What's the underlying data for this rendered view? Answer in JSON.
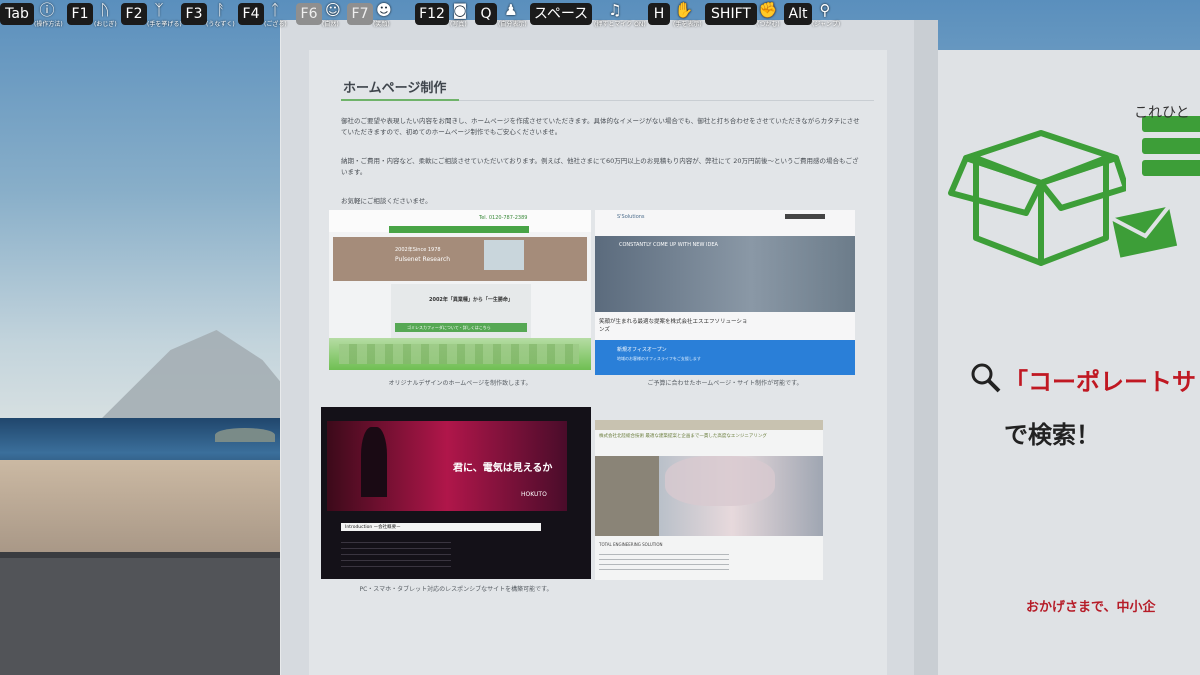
{
  "hud": {
    "keys": [
      {
        "key": "Tab",
        "icon": "info-icon",
        "label": "(操作方法)"
      },
      {
        "key": "F1",
        "icon": "bow-icon",
        "label": "(おじぎ)"
      },
      {
        "key": "F2",
        "icon": "raise-hand-icon",
        "label": "(手を挙げる)"
      },
      {
        "key": "F3",
        "icon": "nod-icon",
        "label": "(うなずく)"
      },
      {
        "key": "F4",
        "icon": "point-icon",
        "label": "(ござる)"
      },
      {
        "key": "F6",
        "icon": "smile-icon",
        "label": "(自然)"
      },
      {
        "key": "F7",
        "icon": "laugh-icon",
        "label": "(笑顔)"
      },
      {
        "key": "F12",
        "icon": "camera-icon",
        "label": "(写真)"
      },
      {
        "key": "Q",
        "icon": "self-view-icon",
        "label": "(自分表示)"
      },
      {
        "key": "スペース",
        "icon": "mic-icon",
        "label": "(押すとマイク ON)"
      },
      {
        "key": "H",
        "icon": "hand-icon",
        "label": "(手を表示)"
      },
      {
        "key": "SHIFT",
        "icon": "grab-icon",
        "label": "(つかむ)"
      },
      {
        "key": "Alt",
        "icon": "jump-icon",
        "label": "(ジャンプ)"
      }
    ]
  },
  "panel": {
    "title": "ホームページ制作",
    "para1": "御社のご要望や表現したい内容をお聞きし、ホームページを作成させていただきます。具体的なイメージがない場合でも、御社と打ち合わせをさせていただきながらカタチにさせていただきますので、初めてのホームページ制作でもご安心くださいませ。",
    "para2": "納期・ご費用・内容など、柔軟にご相談させていただいております。例えば、他社さまにて60万円以上のお見積もり内容が、弊社にて 20万円前後～というご費用感の場合もございます。",
    "para3": "お気軽にご相談くださいませ。",
    "captions": [
      "オリジナルデザインのホームページを制作致します。",
      "ご予算に合わせたホームページ・サイト制作が可能です。",
      "PC・スマホ・タブレット対応のレスポンシブなサイトを構築可能です。"
    ],
    "shot1": {
      "tel": "Tel. 0120-787-2389",
      "hero_title": "2002年Since 1978",
      "hero_sub": "Pulsenet Research",
      "banner": "2002年「異業種」から「一生勝命」",
      "cta": "ゴミレスカフィーダについて・詳しくはこちら"
    },
    "shot2": {
      "logo": "S'Solutions",
      "hero": "CONSTANTLY COME UP WITH NEW IDEA",
      "tagline": "笑顔が生まれる最適な提案を株式会社エスエフソリューションズ",
      "blue_bar": "新規オフィスオープン",
      "blue_sub": "地域のお客様のオフィスライフをご支援します"
    },
    "shot3": {
      "headline": "君に、電気は見えるか",
      "brand": "HOKUTO",
      "section": "Introduction ー会社概要ー"
    },
    "shot4": {
      "heading": "株式会社北陸総合技術 最適な建築提案と企画まで一貫した高度なエンジニアリング",
      "footer": "TOTAL ENGINEERING SOLUTION"
    }
  },
  "right_panel": {
    "heading": "これひと",
    "search_text": "「コーポレートサ",
    "search_suffix": "で検索！",
    "bottom": "おかげさまで、中小企"
  },
  "colors": {
    "accent_green": "#6fb36a",
    "brand_red": "#c01822",
    "icon_green": "#3d9e38"
  }
}
